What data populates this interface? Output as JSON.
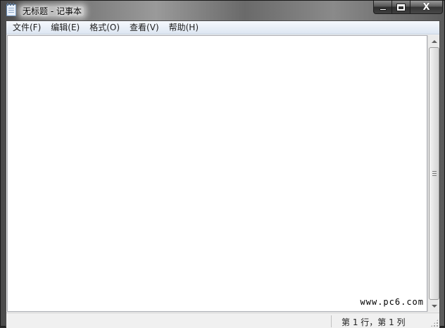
{
  "window": {
    "title": "无标题 - 记事本",
    "app_icon": "notepad-icon"
  },
  "caption": {
    "minimize_icon": "minimize-icon",
    "maximize_icon": "maximize-icon",
    "close_icon": "close-icon",
    "close_glyph": "X"
  },
  "menubar": {
    "items": [
      {
        "label": "文件(F)"
      },
      {
        "label": "编辑(E)"
      },
      {
        "label": "格式(O)"
      },
      {
        "label": "查看(V)"
      },
      {
        "label": "帮助(H)"
      }
    ]
  },
  "editor": {
    "content": "",
    "watermark": "www.pc6.com"
  },
  "statusbar": {
    "position": "第 1 行，第 1 列"
  }
}
